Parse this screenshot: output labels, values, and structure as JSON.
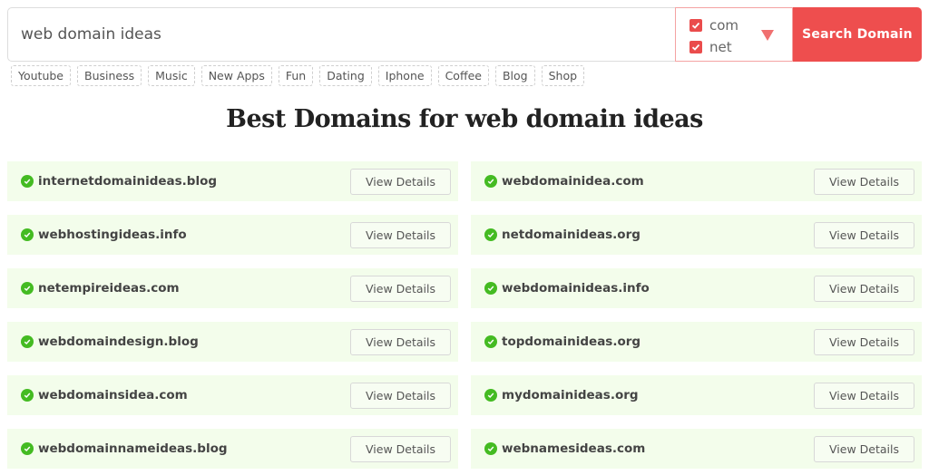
{
  "search": {
    "value": "web domain ideas",
    "button_label": "Search Domain",
    "tlds": [
      {
        "label": "com",
        "checked": true
      },
      {
        "label": "net",
        "checked": true
      }
    ]
  },
  "tags": [
    "Youtube",
    "Business",
    "Music",
    "New Apps",
    "Fun",
    "Dating",
    "Iphone",
    "Coffee",
    "Blog",
    "Shop"
  ],
  "heading": {
    "prefix": "Best Domains for ",
    "query": "web domain ideas"
  },
  "results": {
    "button_label": "View Details",
    "domains": [
      "internetdomainideas.blog",
      "webdomainidea.com",
      "webhostingideas.info",
      "netdomainideas.org",
      "netempireideas.com",
      "webdomainideas.info",
      "webdomaindesign.blog",
      "topdomainideas.org",
      "webdomainsidea.com",
      "mydomainideas.org",
      "webdomainnameideas.blog",
      "webnamesideas.com"
    ]
  },
  "colors": {
    "accent": "#ee4e4e",
    "available": "#44bb22",
    "card_bg": "#f3fdeb"
  }
}
